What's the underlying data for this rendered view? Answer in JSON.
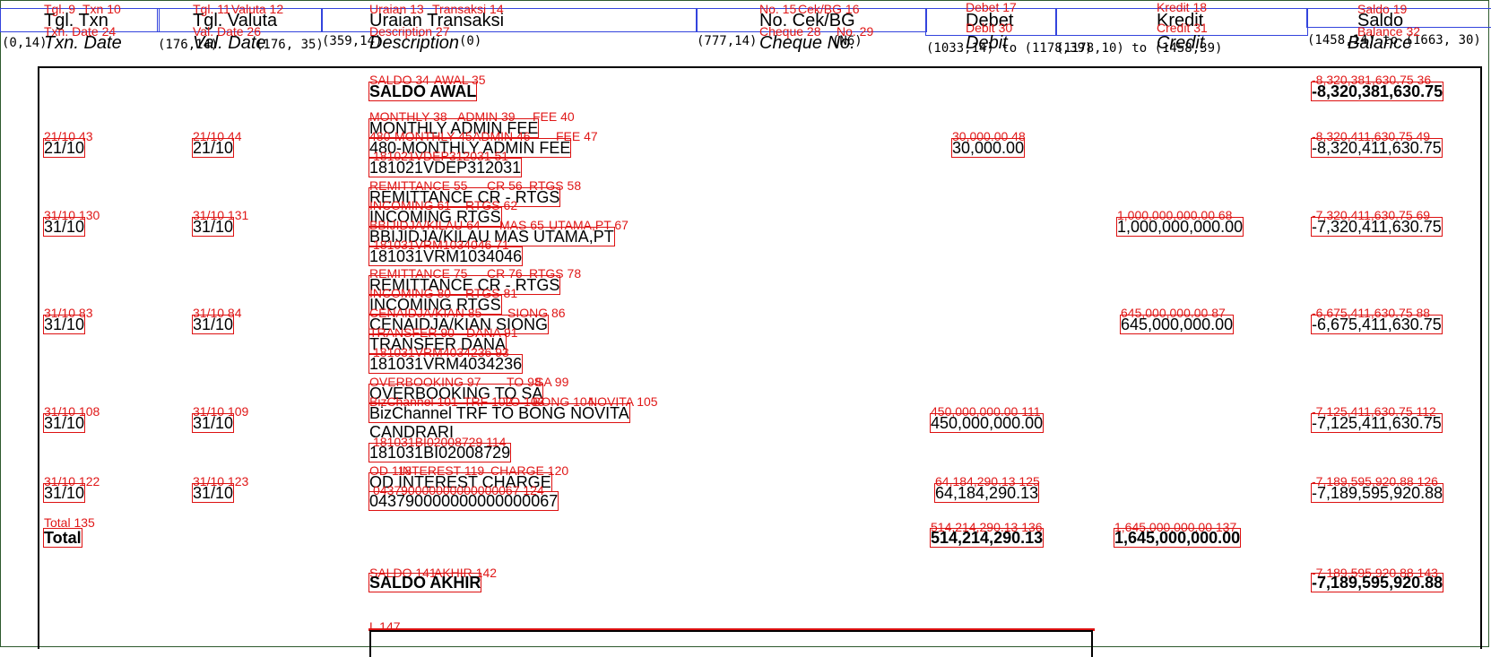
{
  "header": {
    "txn_date": {
      "id": "Tgl. Txn",
      "en": "Txn. Date"
    },
    "val_date": {
      "id": "Tgl. Valuta",
      "en": "Val. Date"
    },
    "description": {
      "id": "Uraian Transaksi",
      "en": "Description"
    },
    "cheque": {
      "id": "No. Cek/BG",
      "en": "Cheque No."
    },
    "debit": {
      "id": "Debet",
      "en": "Debit"
    },
    "credit": {
      "id": "Kredit",
      "en": "Credit"
    },
    "balance": {
      "id": "Saldo",
      "en": "Balance"
    }
  },
  "coords": {
    "c0": "(0,14)",
    "c1": "(176,14)",
    "c2": "(359,14)",
    "c3": "(777,14)",
    "c4": "(1033,14) to (1178,39)",
    "c5": "(1178,10) to (1458,39)",
    "c6": "(1458,14) to (1663, 30)",
    "c7": "(359, 35)",
    "c8": "(0)",
    "c9": "(176, 35)",
    "c10": "(N6)"
  },
  "opening": {
    "label": "SALDO AWAL",
    "balance": "-8,320,381,630.75"
  },
  "rows": [
    {
      "txn": "21/10",
      "val": "21/10",
      "desc": [
        "MONTHLY ADMIN FEE",
        "480-MONTHLY ADMIN FEE",
        "181021VDEP312031"
      ],
      "debit": "30,000.00",
      "credit": "",
      "balance": "-8,320,411,630.75"
    },
    {
      "txn": "31/10",
      "val": "31/10",
      "desc": [
        "REMITTANCE CR - RTGS",
        "INCOMING RTGS",
        "BBIJIDJA/KILAU MAS UTAMA,PT",
        "181031VRM1034046"
      ],
      "debit": "",
      "credit": "1,000,000,000.00",
      "balance": "-7,320,411,630.75"
    },
    {
      "txn": "31/10",
      "val": "31/10",
      "desc": [
        "REMITTANCE CR - RTGS",
        "INCOMING RTGS",
        "CENAIDJA/KIAN SIONG",
        "TRANSFER DANA",
        "181031VRM4034236"
      ],
      "debit": "",
      "credit": "645,000,000.00",
      "balance": "-6,675,411,630.75"
    },
    {
      "txn": "31/10",
      "val": "31/10",
      "desc": [
        "OVERBOOKING TO SA",
        "BizChannel TRF TO BONG NOVITA",
        "CANDRARI",
        "181031BI02008729"
      ],
      "debit": "450,000,000.00",
      "credit": "",
      "balance": "-7,125,411,630.75"
    },
    {
      "txn": "31/10",
      "val": "31/10",
      "desc": [
        "OD INTEREST CHARGE",
        "043790000000000000067"
      ],
      "debit": "64,184,290.13",
      "credit": "",
      "balance": "-7,189,595,920.88"
    }
  ],
  "total": {
    "label": "Total",
    "debit": "514,214,290.13",
    "credit": "1,645,000,000.00"
  },
  "closing": {
    "label": "SALDO AKHIR",
    "balance": "-7,189,595,920.88"
  },
  "tags": {
    "t9": "Tgl. 9",
    "t10": "Txn 10",
    "t11": "Tgl. 11",
    "t12": "Valuta 12",
    "t13": "Uraian 13",
    "t14": "Transaksi 14",
    "t15": "No. 15",
    "t16": "Cek/BG 16",
    "t17": "Debet 17",
    "t18": "Kredit 18",
    "t19": "Saldo 19",
    "t24": "Txn. Date 24",
    "t26": "Val. Date 26",
    "t27": "Description 27",
    "t28": "Cheque 28",
    "t29": "No. 29",
    "t30": "Debit 30",
    "t31": "Credit 31",
    "t32": "Balance 32",
    "t34": "SALDO 34",
    "t35": "AWAL 35",
    "t36": "-8,320,381,630.75 36",
    "t38": "MONTHLY 38",
    "t39": "ADMIN 39",
    "t40": "FEE 40",
    "t43": "21/10 43",
    "t44": "21/10 44",
    "t45": "480-MONTHLY 45",
    "t46": "ADMIN 46",
    "t47": "FEE 47",
    "t48": "30,000.00 48",
    "t49": "-8,320,411,630.75 49",
    "t51": "181021VDEP312031 51",
    "t55": "REMITTANCE 55",
    "t56": "CR 56",
    "t58": "RTGS 58",
    "t61": "INCOMING 61",
    "t62": "RTGS 62",
    "t64": "BBIJIDJA/KILAU 64",
    "t65": "MAS 65",
    "t67": "UTAMA,PT 67",
    "t68": "1,000,000,000.00 68",
    "t69": "-7,320,411,630.75 69",
    "t71": "181031VRM1034046 71",
    "t130": "31/10 130",
    "t131": "31/10 131",
    "t75": "REMITTANCE 75",
    "t76": "CR 76",
    "t78": "RTGS 78",
    "t80": "INCOMING 80",
    "t81": "RTGS 81",
    "t83": "31/10 83",
    "t84": "31/10 84",
    "t85": "CENAIDJA/KIAN 85",
    "t86": "SIONG 86",
    "t87": "645,000,000.00 87",
    "t88": "-6,675,411,630.75 88",
    "t90": "TRANSFER 90",
    "t91": "DANA 91",
    "t93": "181031VRM4034236 93",
    "t97": "OVERBOOKING 97",
    "t98": "TO 98",
    "t99": "SA 99",
    "t101": "BizChannel 101",
    "t102": "TRF 102",
    "t103": "TO 103",
    "t104": "BONG 104",
    "t105": "NOVITA 105",
    "t108": "31/10 108",
    "t109": "31/10 109",
    "t111": "450,000,000.00 111",
    "t112": "-7,125,411,630.75 112",
    "t114": "181031BI02008729 114",
    "t118": "OD 118",
    "t119": "INTEREST 119",
    "t120": "CHARGE 120",
    "t122": "31/10 122",
    "t123": "31/10 123",
    "t124": "043790000000000000067 124",
    "t125": "64,184,290.13 125",
    "t126": "-7,189,595,920.88 126",
    "t135": "Total 135",
    "t136": "514,214,290.13 136",
    "t137": "1,645,000,000.00 137",
    "t141": "SALDO 141",
    "t142": "AKHIR 142",
    "t143": "-7,189,595,920.88 143",
    "t147": "L 147"
  }
}
